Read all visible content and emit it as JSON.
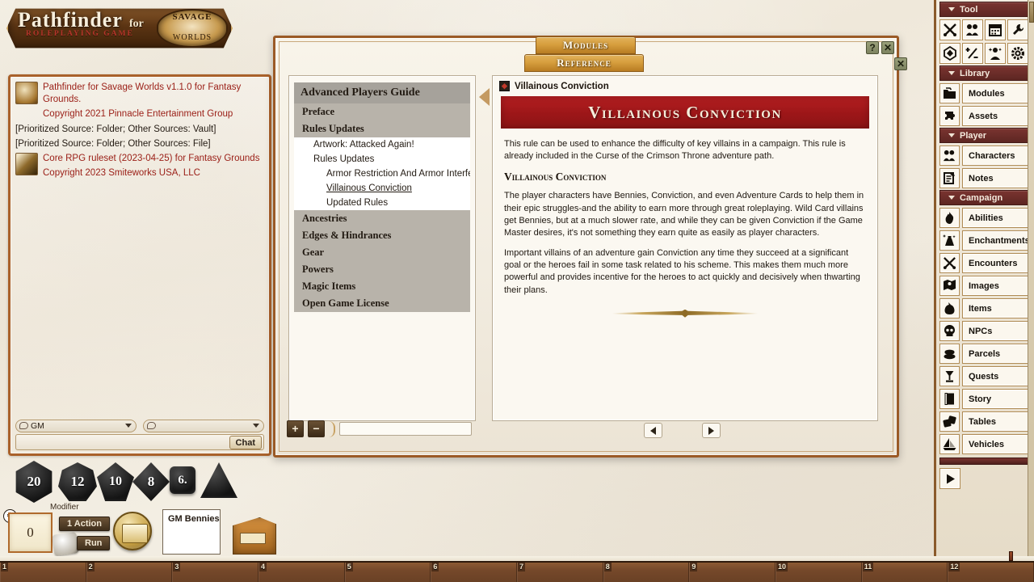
{
  "app": {
    "logo_title": "Pathfinder",
    "logo_sub": "ROLEPLAYING GAME",
    "logo_for": "for",
    "logo_savage_top": "SAVAGE",
    "logo_savage_bottom": "WORLDS"
  },
  "chat": {
    "messages": [
      {
        "type": "icon_red",
        "lines": [
          "Pathfinder for Savage Worlds v1.1.0 for Fantasy Grounds.",
          "Copyright 2021 Pinnacle Entertainment Group"
        ]
      },
      {
        "type": "plain",
        "lines": [
          "[Prioritized Source: Folder; Other Sources: Vault]"
        ]
      },
      {
        "type": "plain",
        "lines": [
          "[Prioritized Source: Folder; Other Sources: File]"
        ]
      },
      {
        "type": "icon_red",
        "lines": [
          "Core RPG ruleset (2023-04-25) for Fantasy Grounds",
          "Copyright 2023 Smiteworks USA, LLC"
        ]
      }
    ],
    "identity_label": "GM",
    "identity_label_2": "",
    "entry_value": "",
    "chat_button": "Chat"
  },
  "dice": {
    "tray": [
      {
        "name": "d20",
        "label": "20"
      },
      {
        "name": "d12",
        "label": "12"
      },
      {
        "name": "d10",
        "label": "10"
      },
      {
        "name": "d8",
        "label": "8"
      },
      {
        "name": "d6",
        "label": "6."
      },
      {
        "name": "d4",
        "label": ""
      }
    ],
    "modifier_label": "Modifier",
    "modifier_value": "0",
    "action_button": "1 Action",
    "run_button": "Run",
    "gm_bennies_label": "GM Bennies"
  },
  "window": {
    "tabs": [
      {
        "label": "Modules",
        "active": false
      },
      {
        "label": "Reference",
        "active": true
      }
    ],
    "buttons": {
      "help": "?",
      "close": "✕",
      "close2": "✕"
    },
    "footer": {
      "add": "+",
      "remove": "−",
      "input_value": "",
      "prev": "◀",
      "next": "▶"
    }
  },
  "tree": {
    "title": "Advanced Players Guide",
    "items": [
      {
        "label": "Preface",
        "level": 0,
        "selected": false
      },
      {
        "label": "Rules Updates",
        "level": 0,
        "selected": false
      },
      {
        "label": "Artwork: Attacked Again!",
        "level": 1,
        "selected": false
      },
      {
        "label": "Rules Updates",
        "level": 1,
        "selected": false
      },
      {
        "label": "Armor Restriction And Armor Interferenc",
        "level": 2,
        "selected": false
      },
      {
        "label": "Villainous Conviction",
        "level": 2,
        "selected": true
      },
      {
        "label": "Updated Rules",
        "level": 2,
        "selected": false
      },
      {
        "label": "Ancestries",
        "level": 0,
        "selected": false
      },
      {
        "label": "Edges & Hindrances",
        "level": 0,
        "selected": false
      },
      {
        "label": "Gear",
        "level": 0,
        "selected": false
      },
      {
        "label": "Powers",
        "level": 0,
        "selected": false
      },
      {
        "label": "Magic Items",
        "level": 0,
        "selected": false
      },
      {
        "label": "Open Game License",
        "level": 0,
        "selected": false
      }
    ]
  },
  "article": {
    "header_title": "Villainous Conviction",
    "banner_title": "Villainous Conviction",
    "intro": "This rule can be used to enhance the difficulty of key villains in a campaign. This rule is already included in the Curse of the Crimson Throne adventure path.",
    "section_heading": "Villainous Conviction",
    "paragraphs": [
      "The player characters have Bennies, Conviction, and even Adventure Cards to help them in their epic struggles-and the ability to earn more through great roleplaying. Wild Card villains get Bennies, but at a much slower rate, and while they can be given Conviction if the Game Master desires, it's not something they earn quite as easily as player characters.",
      "Important villains of an adventure gain Conviction any time they succeed at a significant goal or the heroes fail in some task related to his scheme. This makes them much more powerful and provides incentive for the heroes to act quickly and decisively when thwarting their plans."
    ]
  },
  "sidebar": {
    "groups": [
      {
        "label": "Tool"
      },
      {
        "label": "Library"
      },
      {
        "label": "Player"
      },
      {
        "label": "Campaign"
      }
    ],
    "tool_icons": [
      {
        "name": "crossed-swords-icon"
      },
      {
        "name": "party-icon"
      },
      {
        "name": "calendar-icon"
      },
      {
        "name": "wrench-icon"
      },
      {
        "name": "polyhedral-die-icon"
      },
      {
        "name": "plus-minus-icon"
      },
      {
        "name": "effects-icon"
      },
      {
        "name": "gear-icon"
      }
    ],
    "library_items": [
      {
        "label": "Modules",
        "icon": "folder-icon"
      },
      {
        "label": "Assets",
        "icon": "puzzle-icon"
      }
    ],
    "player_items": [
      {
        "label": "Characters",
        "icon": "party-icon"
      },
      {
        "label": "Notes",
        "icon": "notes-icon"
      }
    ],
    "campaign_items": [
      {
        "label": "Abilities",
        "icon": "flame-icon"
      },
      {
        "label": "Enchantments",
        "icon": "sparkle-potion-icon"
      },
      {
        "label": "Encounters",
        "icon": "crossed-swords-icon"
      },
      {
        "label": "Images",
        "icon": "map-icon"
      },
      {
        "label": "Items",
        "icon": "bag-icon"
      },
      {
        "label": "NPCs",
        "icon": "skull-icon"
      },
      {
        "label": "Parcels",
        "icon": "coins-icon"
      },
      {
        "label": "Quests",
        "icon": "goblet-icon"
      },
      {
        "label": "Story",
        "icon": "book-icon"
      },
      {
        "label": "Tables",
        "icon": "dice-icon"
      },
      {
        "label": "Vehicles",
        "icon": "ship-icon"
      }
    ],
    "play_button": "▶"
  },
  "hotbar": {
    "slots": [
      "1",
      "2",
      "3",
      "4",
      "5",
      "6",
      "7",
      "8",
      "9",
      "10",
      "11",
      "12"
    ]
  },
  "colors": {
    "accent_brown": "#8a5a2b",
    "banner_red": "#9c1618",
    "sidebar_group": "#5d2622",
    "tab_gold": "#d79f3e"
  }
}
